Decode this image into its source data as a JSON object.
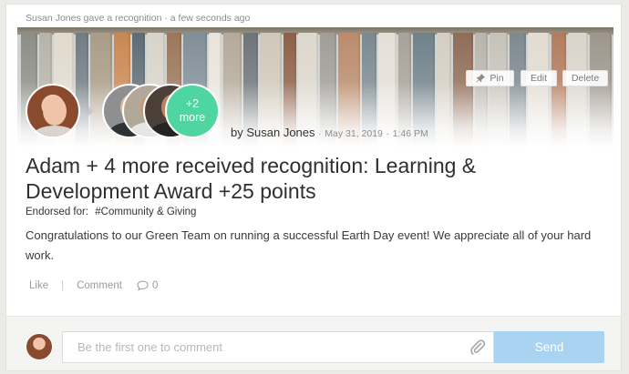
{
  "feed_item": {
    "meta": {
      "giver": "Susan Jones",
      "action": "gave a recognition",
      "separator": "·",
      "time_ago": "a few seconds ago"
    },
    "banner_buttons": {
      "pin_label": "Pin",
      "edit_label": "Edit",
      "delete_label": "Delete"
    },
    "recipients_more": {
      "count": "+2",
      "label": "more"
    },
    "byline": {
      "by_text": "by Susan Jones",
      "separator": "·",
      "date": "May 31, 2019",
      "time": "1:46 PM"
    },
    "headline": "Adam + 4 more received recognition: Learning & Development Award +25 points",
    "endorsed": {
      "label": "Endorsed for:",
      "tag": "#Community & Giving"
    },
    "message": "Congratulations to our Green Team on running a successful Earth Day event! We appreciate all of your hard work.",
    "actions": {
      "like_label": "Like",
      "separator": "|",
      "comment_label": "Comment",
      "comment_count": "0"
    }
  },
  "comment_box": {
    "placeholder": "Be the first one to comment",
    "value": "",
    "send_label": "Send"
  },
  "icons": {
    "pin": "pin-icon",
    "attach": "paperclip-icon",
    "comment": "speech-bubble-icon"
  },
  "colors": {
    "accent_green": "#4fd6a0",
    "send_button": "#a9d3f1",
    "background": "#ecebe8"
  }
}
